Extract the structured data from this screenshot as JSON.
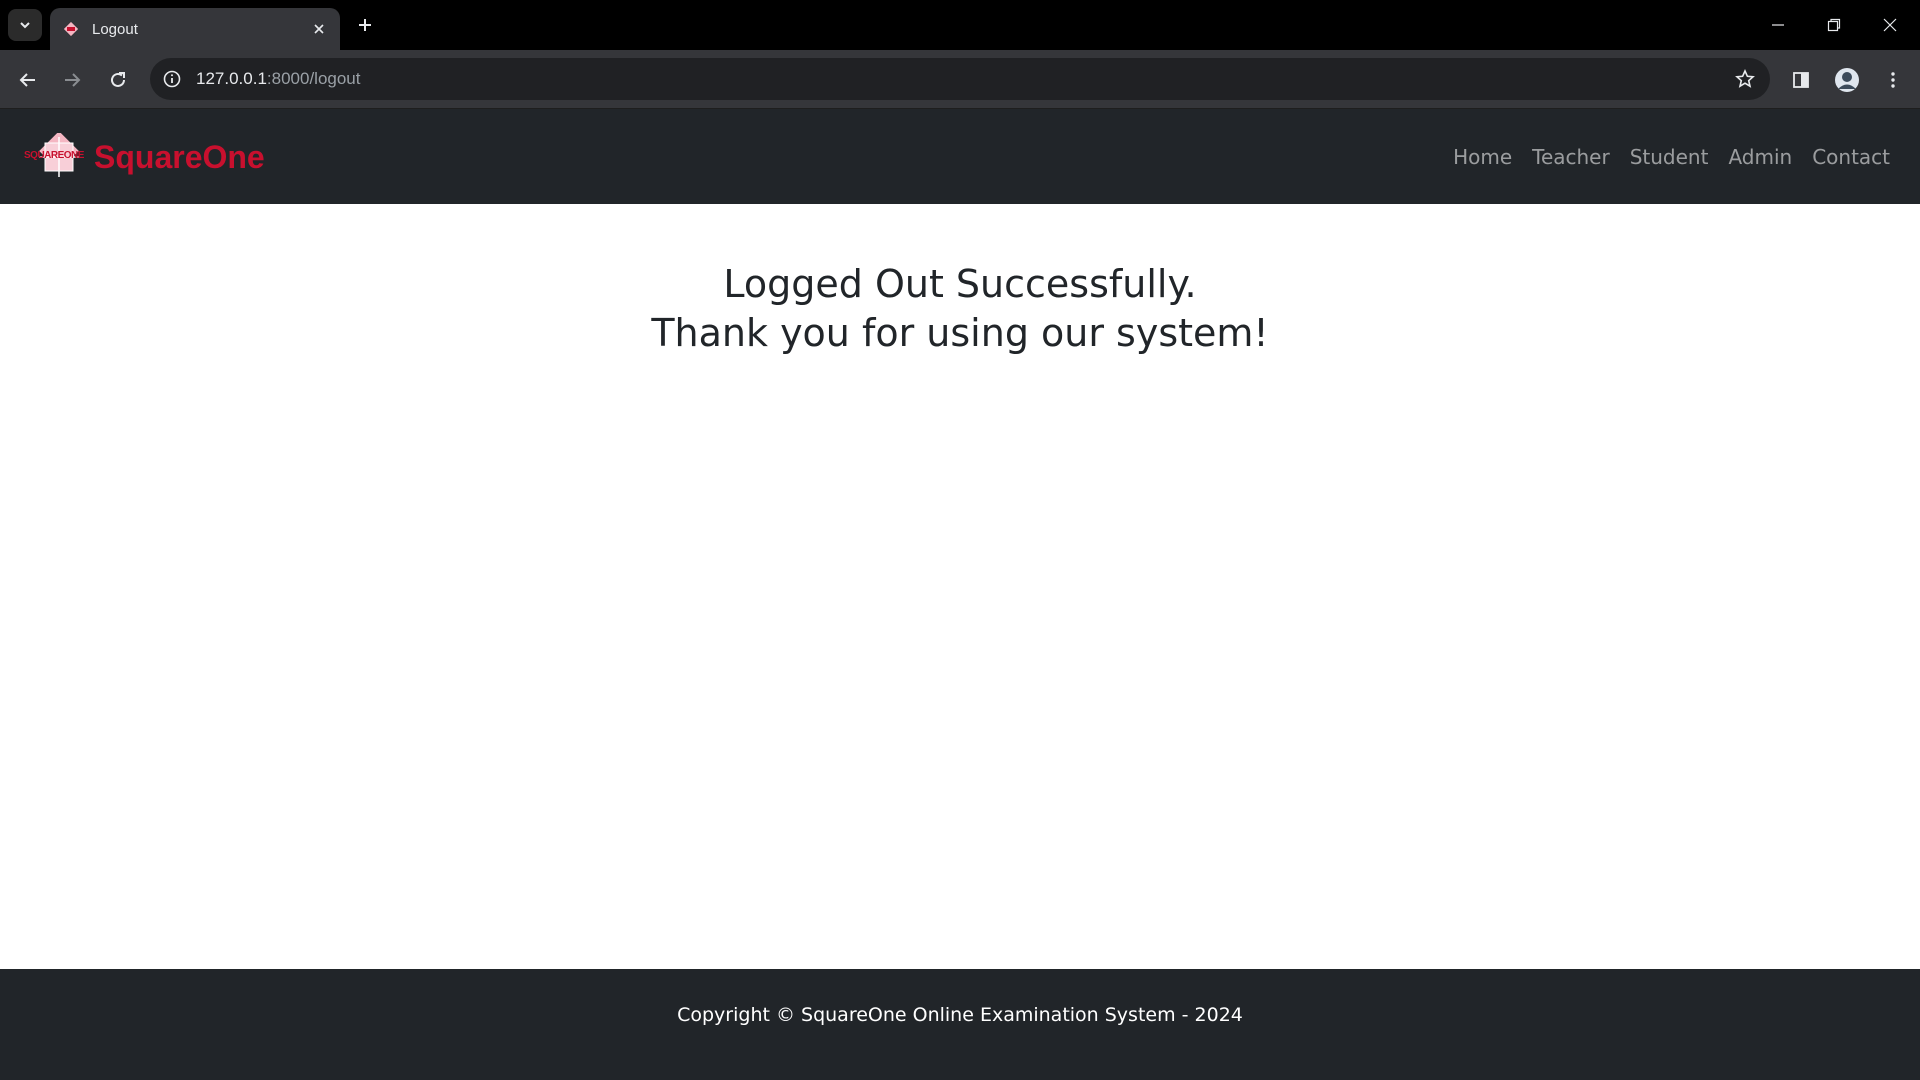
{
  "browser": {
    "tab_title": "Logout",
    "url_host": "127.0.0.1",
    "url_rest": ":8000/logout",
    "accent": "#c8102e"
  },
  "navbar": {
    "brand": "SquareOne",
    "logo_text": "SQUAREONE",
    "links": [
      "Home",
      "Teacher",
      "Student",
      "Admin",
      "Contact"
    ]
  },
  "main": {
    "line1": "Logged Out Successfully.",
    "line2": "Thank you for using our system!"
  },
  "footer": {
    "copyright": "Copyright © SquareOne Online Examination System - 2024"
  }
}
